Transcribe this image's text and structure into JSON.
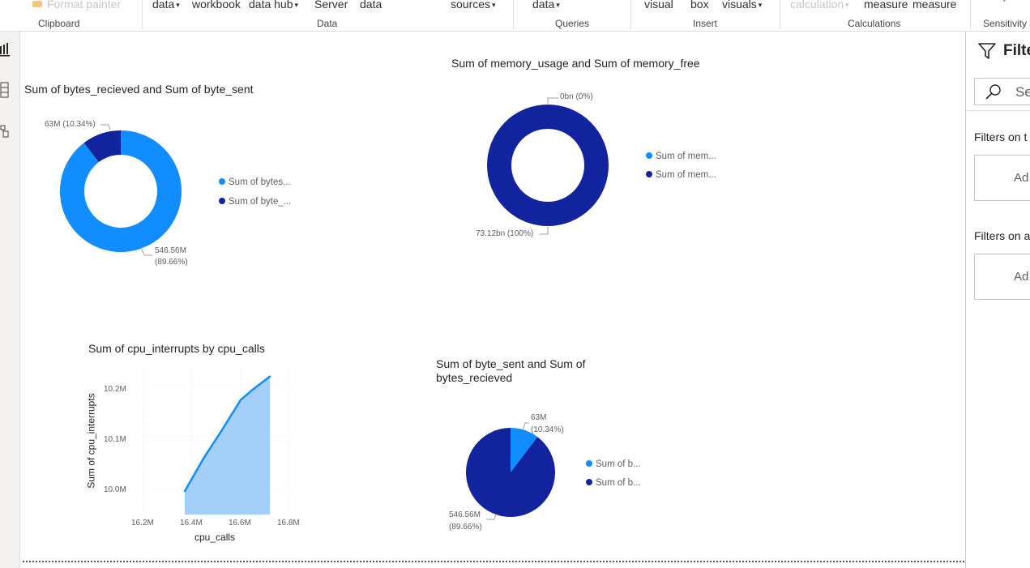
{
  "ribbon": {
    "items": {
      "format_painter": "Format painter",
      "get_data": "data",
      "workbook": "workbook",
      "data_hub": "data hub",
      "server": "Server",
      "data": "data",
      "sources": "sources",
      "transform_data": "data",
      "visual": "visual",
      "box": "box",
      "visuals": "visuals",
      "calculation": "calculation",
      "measure1": "measure",
      "measure2": "measure"
    },
    "groups": {
      "clipboard": "Clipboard",
      "data": "Data",
      "queries": "Queries",
      "insert": "Insert",
      "calculations": "Calculations",
      "sensitivity": "Sensitivity"
    }
  },
  "filter_pane": {
    "title": "Filte",
    "search_placeholder": "Sea",
    "filters_on_this": "Filters on t",
    "add_1": "Ad",
    "filters_on_all": "Filters on a",
    "add_2": "Ad"
  },
  "colors": {
    "light_blue": "#118dff",
    "dark_blue": "#12239e",
    "area_fill": "#a3cff9"
  },
  "chart_data": [
    {
      "type": "donut",
      "title": "Sum of bytes_recieved and Sum of byte_sent",
      "series": [
        {
          "name": "Sum of bytes...",
          "value": 546.56,
          "label": "546.56M",
          "percent_label": "(89.66%)",
          "color": "#118dff"
        },
        {
          "name": "Sum of byte_...",
          "value": 63,
          "label": "63M (10.34%)",
          "color": "#12239e"
        }
      ]
    },
    {
      "type": "donut",
      "title": "Sum of memory_usage and Sum of memory_free",
      "series": [
        {
          "name": "Sum of mem...",
          "value": 0,
          "label": "0bn (0%)",
          "color": "#118dff"
        },
        {
          "name": "Sum of mem...",
          "value": 73.12,
          "label": "73.12bn (100%)",
          "color": "#12239e"
        }
      ]
    },
    {
      "type": "area",
      "title": "Sum of cpu_interrupts by cpu_calls",
      "xlabel": "cpu_calls",
      "ylabel": "Sum of cpu_interrupts",
      "x_ticks": [
        "16.2M",
        "16.4M",
        "16.6M",
        "16.8M"
      ],
      "y_ticks": [
        "10.2M",
        "10.1M",
        "10.0M"
      ],
      "xlim": [
        16.2,
        16.8
      ],
      "ylim": [
        9.95,
        10.23
      ],
      "x": [
        16.37,
        16.45,
        16.52,
        16.6,
        16.65,
        16.72
      ],
      "y": [
        9.995,
        10.06,
        10.11,
        10.17,
        10.19,
        10.215
      ]
    },
    {
      "type": "pie",
      "title_line1": "Sum of byte_sent and Sum of",
      "title_line2": "bytes_recieved",
      "series": [
        {
          "name": "Sum of b...",
          "value": 63,
          "label": "63M",
          "percent_label": "(10.34%)",
          "color": "#118dff"
        },
        {
          "name": "Sum of b...",
          "value": 546.56,
          "label": "546.56M",
          "percent_label": "(89.66%)",
          "color": "#12239e"
        }
      ]
    }
  ]
}
